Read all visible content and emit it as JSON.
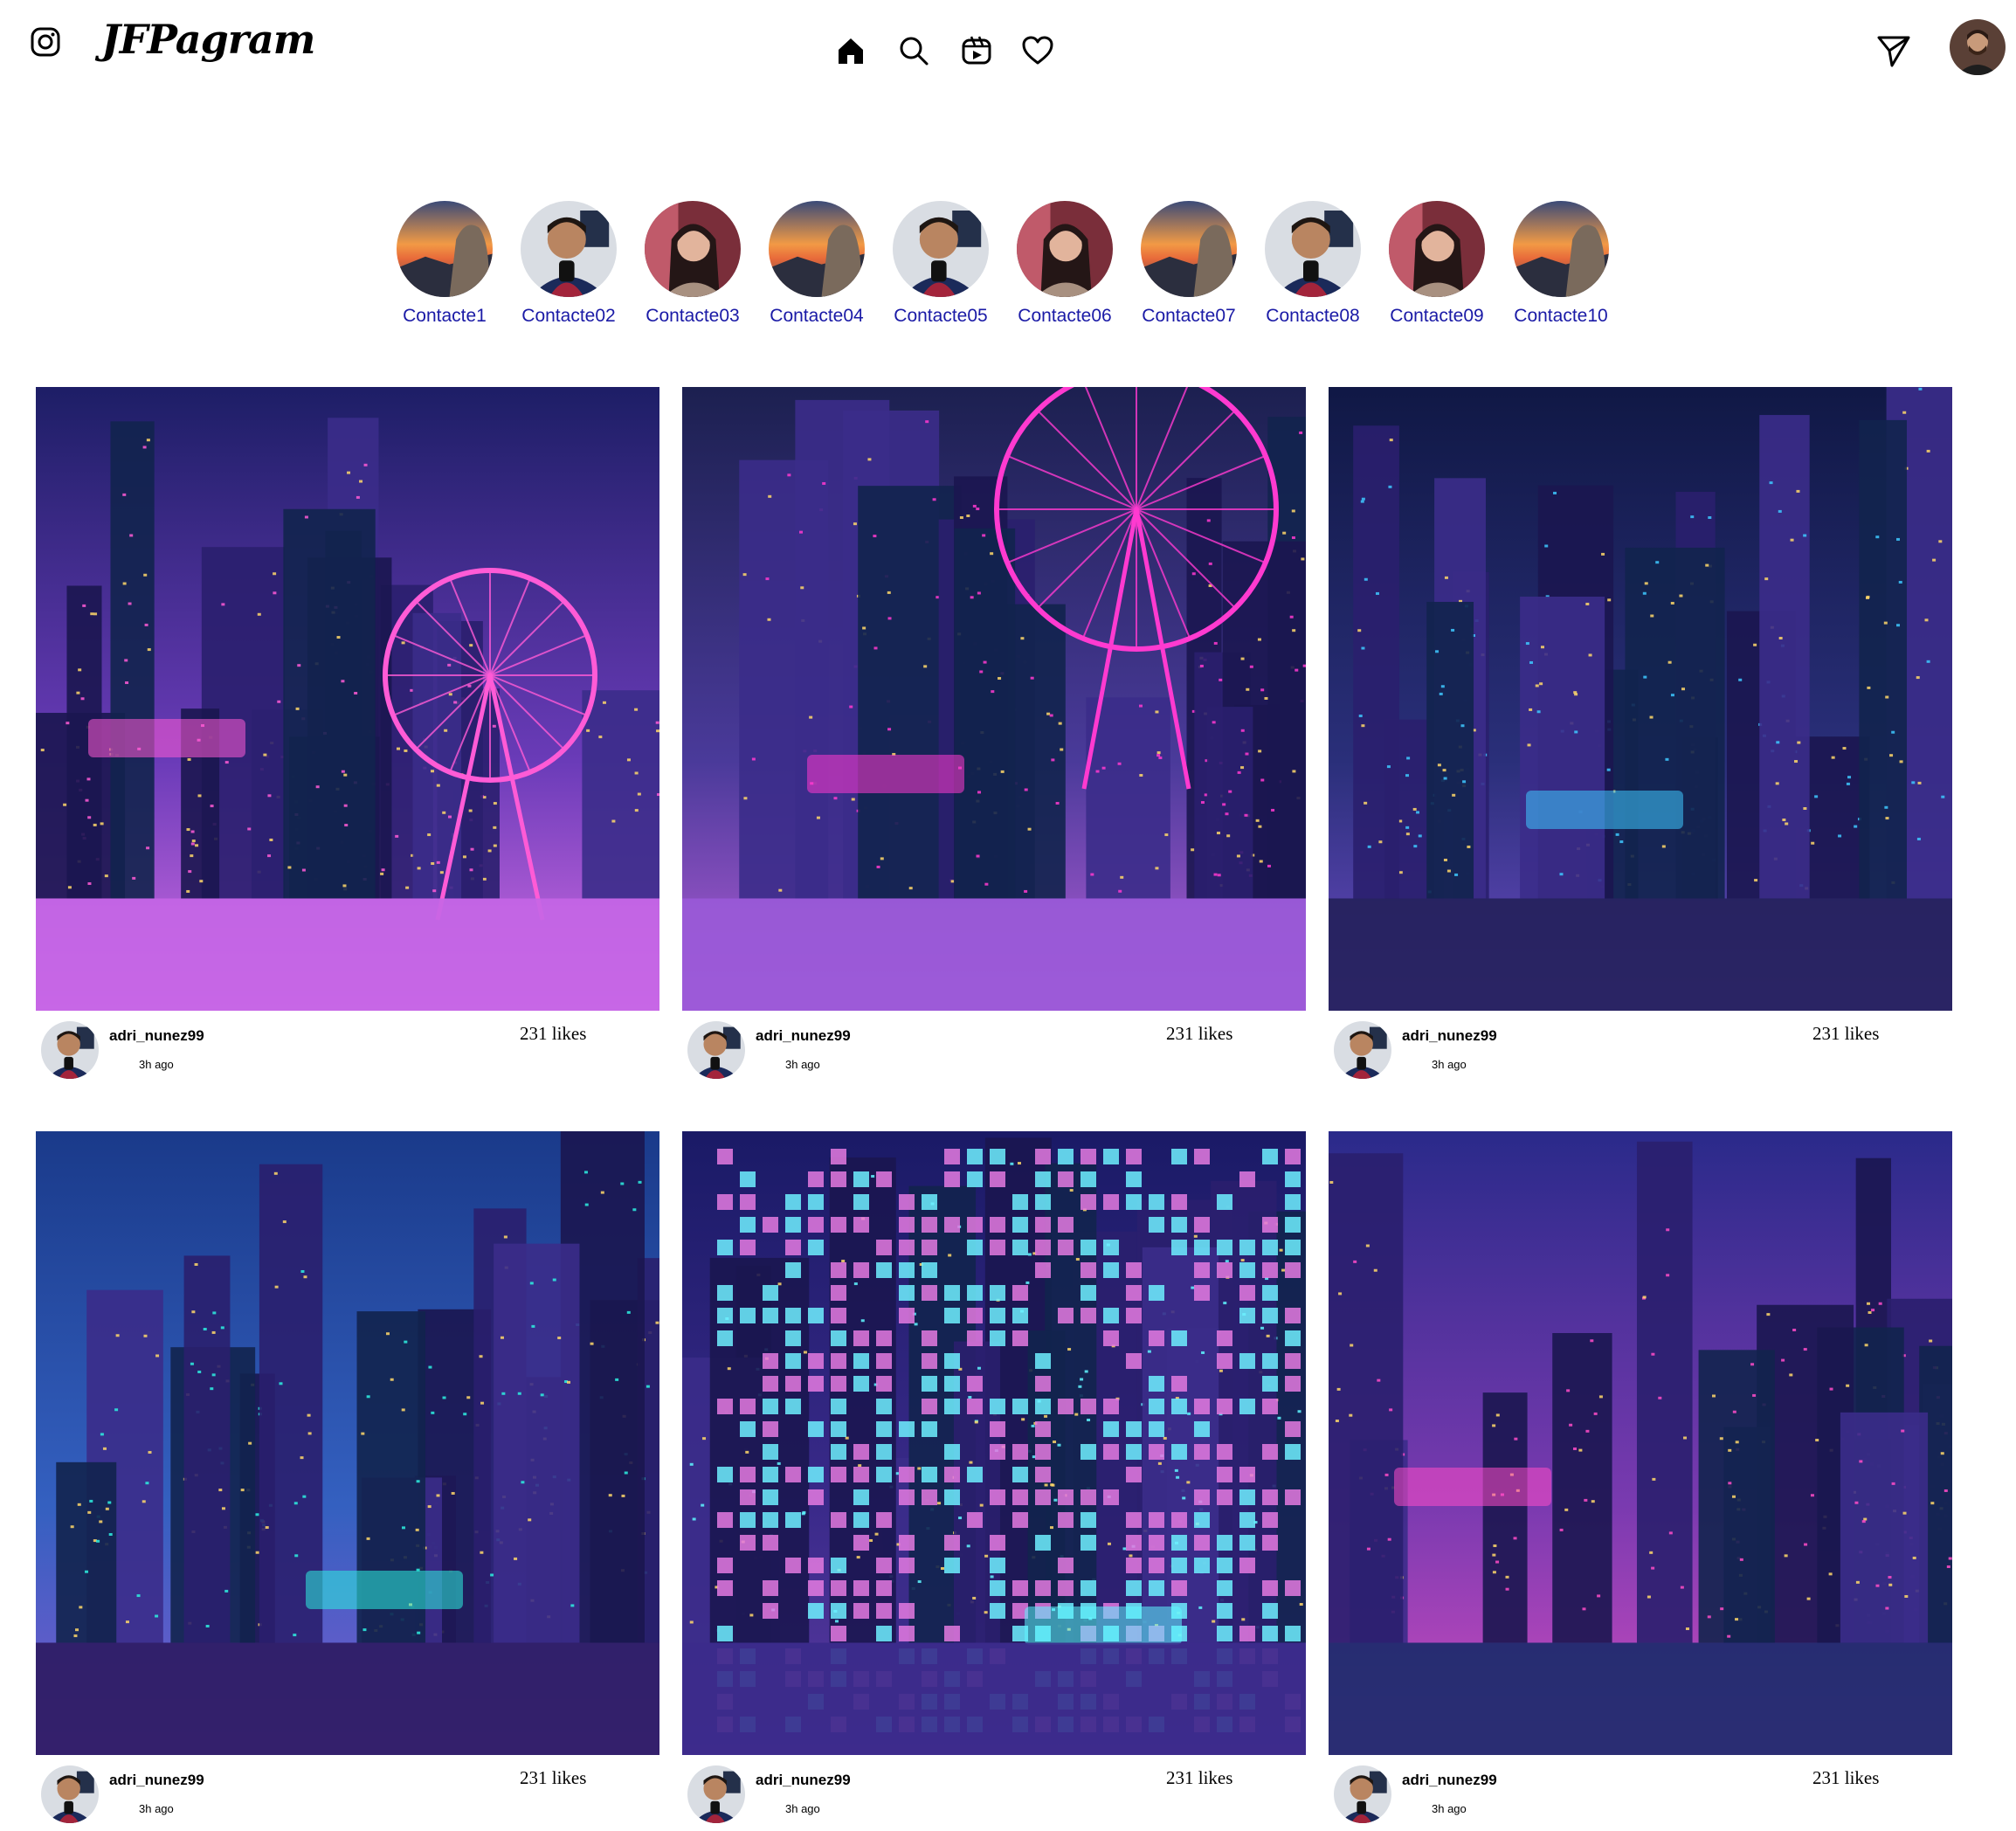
{
  "header": {
    "brand": "JFPagram",
    "icons": {
      "logo": "instagram-icon",
      "home": "home-icon",
      "search": "search-icon",
      "reels": "reels-icon",
      "activity": "heart-icon",
      "direct": "send-icon",
      "profile": "avatar"
    }
  },
  "stories": [
    {
      "label": "Contacte1",
      "avatar": "landscape"
    },
    {
      "label": "Contacte02",
      "avatar": "man"
    },
    {
      "label": "Contacte03",
      "avatar": "woman"
    },
    {
      "label": "Contacte04",
      "avatar": "landscape"
    },
    {
      "label": "Contacte05",
      "avatar": "man"
    },
    {
      "label": "Contacte06",
      "avatar": "woman"
    },
    {
      "label": "Contacte07",
      "avatar": "landscape"
    },
    {
      "label": "Contacte08",
      "avatar": "man"
    },
    {
      "label": "Contacte09",
      "avatar": "woman"
    },
    {
      "label": "Contacte10",
      "avatar": "landscape"
    }
  ],
  "posts": [
    {
      "user": "adri_nunez99",
      "time": "3h ago",
      "likes": "231 likes",
      "image": "neon city with ferris wheel"
    },
    {
      "user": "adri_nunez99",
      "time": "3h ago",
      "likes": "231 likes",
      "image": "neon skyline with pink ferris wheel"
    },
    {
      "user": "adri_nunez99",
      "time": "3h ago",
      "likes": "231 likes",
      "image": "neon towers and pavilion"
    },
    {
      "user": "adri_nunez99",
      "time": "3h ago",
      "likes": "231 likes",
      "image": "neon sign building"
    },
    {
      "user": "adri_nunez99",
      "time": "3h ago",
      "likes": "231 likes",
      "image": "pixel facade"
    },
    {
      "user": "adri_nunez99",
      "time": "3h ago",
      "likes": "231 likes",
      "image": "neon alley buildings"
    }
  ],
  "colors": {
    "story_label": "#1a1aa6",
    "background": "#ffffff"
  }
}
